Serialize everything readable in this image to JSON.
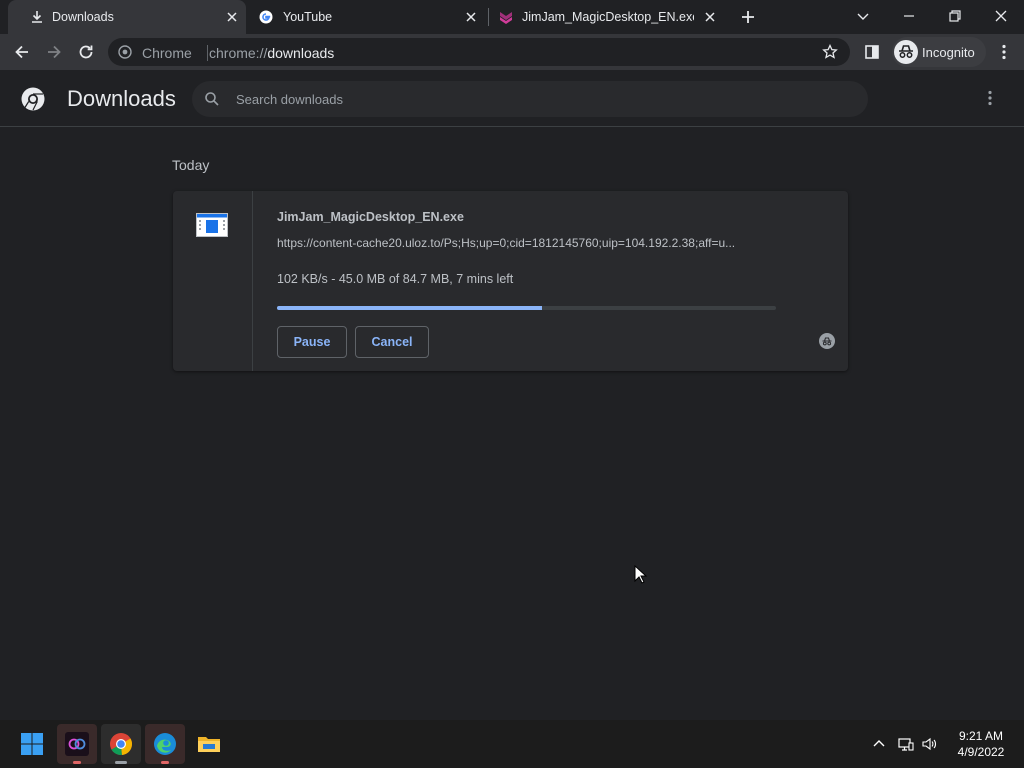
{
  "tabs": [
    {
      "title": "Downloads",
      "icon": "download-icon",
      "active": true
    },
    {
      "title": "YouTube",
      "icon": "google-icon",
      "active": false
    },
    {
      "title": "JimJam_MagicDesktop_EN.exe | U",
      "icon": "uloz-icon",
      "active": false
    }
  ],
  "toolbar": {
    "omnibox_site": "Chrome",
    "url_scheme": "chrome://",
    "url_host": "downloads",
    "incognito_label": "Incognito"
  },
  "page": {
    "title": "Downloads",
    "search_placeholder": "Search downloads",
    "section": "Today"
  },
  "download": {
    "filename": "JimJam_MagicDesktop_EN.exe",
    "url": "https://content-cache20.uloz.to/Ps;Hs;up=0;cid=1812145760;uip=104.192.2.38;aff=u...",
    "status": "102 KB/s - 45.0 MB of 84.7 MB, 7 mins left",
    "progress_fraction": 0.531,
    "pause_label": "Pause",
    "cancel_label": "Cancel"
  },
  "taskbar": {
    "time": "9:21 AM",
    "date": "4/9/2022"
  },
  "colors": {
    "accent": "#8ab4f8",
    "background": "#202124",
    "card": "#292a2d"
  }
}
